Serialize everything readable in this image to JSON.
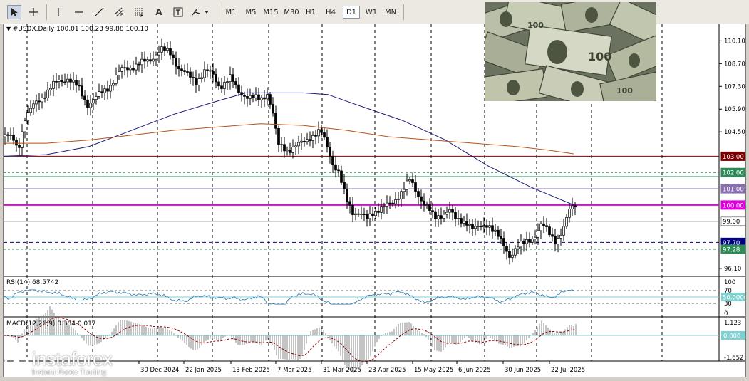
{
  "toolbar": {
    "icons": [
      "cursor-icon",
      "crosshair-icon",
      "vertical-line-icon",
      "horizontal-line-icon",
      "trendline-icon",
      "equidistant-channel-icon",
      "fibonacci-icon",
      "text-icon",
      "text-label-icon",
      "shapes-icon"
    ],
    "text_tool": "A",
    "timeframes": [
      "M1",
      "M5",
      "M15",
      "M30",
      "H1",
      "H4",
      "D1",
      "W1",
      "MN"
    ],
    "active_timeframe": "D1"
  },
  "chart": {
    "header": "#USDX,Daily  100.01 100.23 99.88 100.10",
    "price_axis": [
      "110.10",
      "108.70",
      "107.30",
      "105.90",
      "104.50",
      "96.10"
    ],
    "level_labels": [
      {
        "text": "103.00",
        "price": 103.0,
        "bg": "#7b0000",
        "fg": "#ffffff"
      },
      {
        "text": "102.00",
        "price": 102.0,
        "bg": "#2e8b57",
        "fg": "#ffffff"
      },
      {
        "text": "101.00",
        "price": 101.0,
        "bg": "#8a6fb0",
        "fg": "#ffffff"
      },
      {
        "text": "100.00",
        "price": 100.0,
        "bg": "#e000e0",
        "fg": "#ffffff"
      },
      {
        "text": "99.00",
        "price": 99.0,
        "bg": "#ffffff",
        "fg": "#000000"
      },
      {
        "text": "97.70",
        "price": 97.7,
        "bg": "#000080",
        "fg": "#ffffff"
      },
      {
        "text": "97.28",
        "price": 97.28,
        "bg": "#2e8b57",
        "fg": "#ffffff"
      }
    ],
    "date_axis": [
      "30 Dec 2024",
      "22 Jan 2025",
      "13 Feb 2025",
      "7 Mar 2025",
      "31 Mar 2025",
      "23 Apr 2025",
      "15 May 2025",
      "6 Jun 2025",
      "30 Jun 2025",
      "22 Jul 2025"
    ],
    "colors": {
      "bull": "#000000",
      "bear": "#000000",
      "ma_fast": "#1a1a7a",
      "ma_slow": "#b5541a",
      "rsi": "#1f77b4",
      "macd_signal": "#8b0000"
    }
  },
  "rsi": {
    "label": "RSI(14) 68.5742",
    "axis": [
      "100",
      "70",
      "50.0000",
      "30",
      "0"
    ]
  },
  "macd": {
    "label": "MACD(12,26,9) 0.384 0.017",
    "axis": [
      "1.123",
      "0.000",
      "-1.652"
    ]
  },
  "logo": {
    "name": "instaforex",
    "tagline": "Instant Forex Trading"
  },
  "photo_icon": "dollar-banknotes-image"
}
